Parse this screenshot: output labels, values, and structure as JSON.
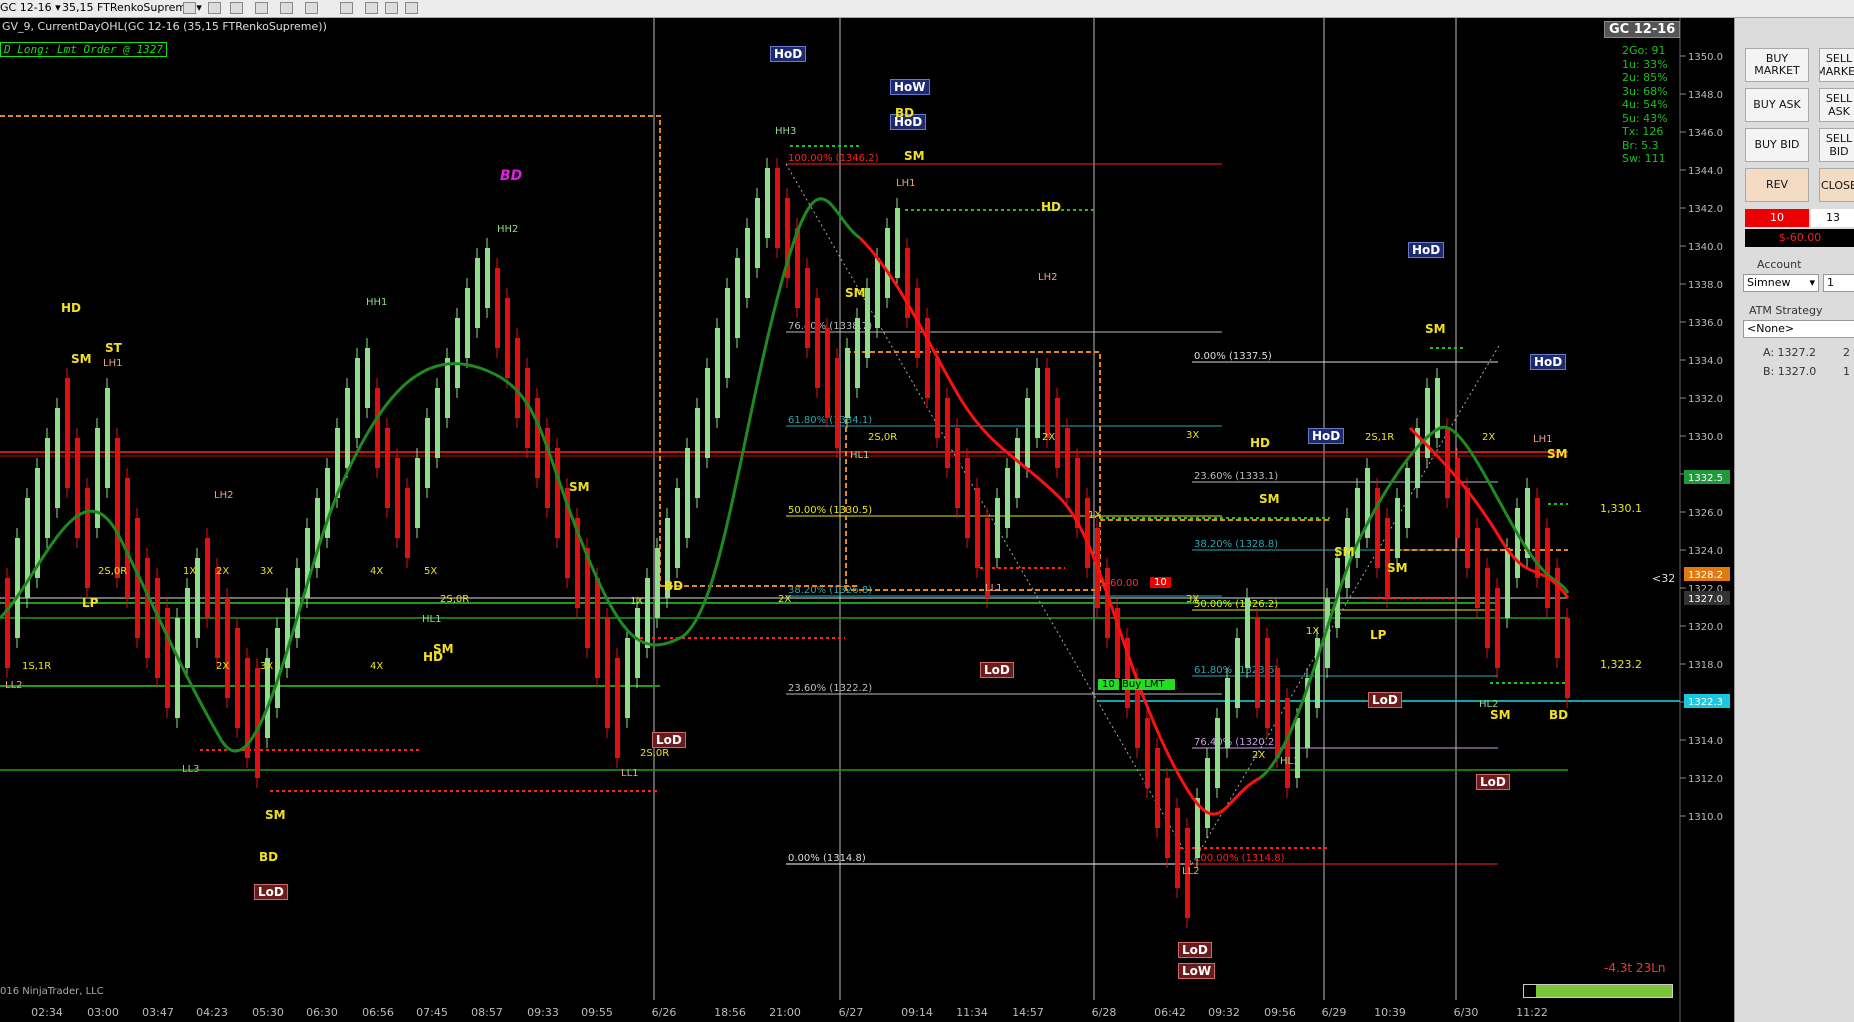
{
  "toolbar": {
    "instrument": "GC 12-16",
    "bar_type": "35,15 FTRenkoSupreme"
  },
  "chart": {
    "indicator_title": "GV_9, CurrentDayOHL(GC 12-16 (35,15 FTRenkoSupreme))",
    "order_banner": "D Long: Lmt Order @ 1327",
    "instrument_tag": "GC 12-16",
    "stats": [
      "2Go: 91",
      "1u: 33%",
      "2u: 85%",
      "3u: 68%",
      "4u: 54%",
      "5u: 43%",
      "Tx: 126",
      "Br: 5.3",
      "Sw: 111"
    ],
    "copyright": "016 NinjaTrader, LLC",
    "pnl_readout": "-4.3t 23Ln",
    "y_axis_labels": [
      "1350.0",
      "1348.0",
      "1346.0",
      "1344.0",
      "1342.0",
      "1340.0",
      "1338.0",
      "1336.0",
      "1334.0",
      "1332.0",
      "1330.0",
      "1328.0",
      "1326.0",
      "1324.0",
      "1322.0",
      "1320.0",
      "1318.0",
      "1316.0",
      "1314.0",
      "1312.0",
      "1310.0"
    ],
    "x_axis_labels": [
      "02:34",
      "03:00",
      "03:47",
      "04:23",
      "05:30",
      "06:30",
      "06:56",
      "07:45",
      "08:57",
      "09:33",
      "09:55",
      "6/26",
      "18:56",
      "21:00",
      "6/27",
      "09:14",
      "11:34",
      "14:57",
      "6/28",
      "06:42",
      "09:32",
      "09:56",
      "6/29",
      "10:39",
      "6/30",
      "11:22"
    ],
    "price_markers": [
      {
        "text": "1332.5",
        "color": "#1f9a3a"
      },
      {
        "text": "1328.2",
        "color": "#e07a10"
      },
      {
        "text": "1327.0",
        "color": "#333333"
      },
      {
        "text": "1322.3",
        "color": "#18c8e0"
      }
    ],
    "fib_levels": [
      "100.00% (1346.2)",
      "76.40% (1338.7)",
      "61.80% (1334.1)",
      "50.00% (1330.5)",
      "38.20% (1326.8)",
      "23.60% (1322.2)",
      "0.00% (1314.8)"
    ],
    "fib_levels_2": [
      "0.00% (1337.5)",
      "23.60% (1333.1)",
      "38.20% (1328.8)",
      "50.00% (1326.2)",
      "61.80% (1323.6)",
      "76.40% (1320.2)",
      "100.00% (1314.8)"
    ],
    "tags": {
      "hod": "HoD",
      "lod": "LoD",
      "how": "HoW",
      "low": "LoW",
      "hd": "HD",
      "sm": "SM",
      "st": "ST",
      "bd": "BD",
      "lp": "LP",
      "hh1": "HH1",
      "hh2": "HH2",
      "hh3": "HH3",
      "lh1": "LH1",
      "lh2": "LH2",
      "ll1": "LL1",
      "ll2": "LL2",
      "ll3": "LL3",
      "hl1": "HL1",
      "hl2": "HL2",
      "x1": "1X",
      "x2": "2X",
      "x3": "3X",
      "x4": "4X",
      "x5": "5X",
      "s20r": "2S,0R",
      "s11r": "1S,1R",
      "s21r": "2S,1R",
      "lvl_right_1": "1,330.1",
      "lvl_right_2": "1,323.2",
      "lt32": "<32",
      "order_qty": "10",
      "order_pnl": "$-60.00",
      "order_label": "Buy LMT"
    }
  },
  "panel": {
    "buy_market": "BUY MARKET",
    "sell_market": "SELL MARKET",
    "buy_ask": "BUY ASK",
    "sell_ask": "SELL ASK",
    "buy_bid": "BUY BID",
    "sell_bid": "SELL BID",
    "rev": "REV",
    "close": "CLOSE",
    "qty": "10",
    "qty2": "13",
    "pnl": "$-60.00",
    "account_label": "Account",
    "account_value": "Simnew",
    "account_qty": "1",
    "atm_label": "ATM Strategy",
    "atm_value": "<None>",
    "ask_line": "A: 1327.2",
    "ask_qty": "2",
    "bid_line": "B: 1327.0",
    "bid_qty": "1"
  },
  "colors": {
    "up_bar": "#8fdc8a",
    "down_bar": "#e01010",
    "ma_green": "#1f8a1f",
    "ma_red": "#ff1010",
    "fib_line": "#c8c8c8",
    "orange_box": "#e08a1a"
  }
}
